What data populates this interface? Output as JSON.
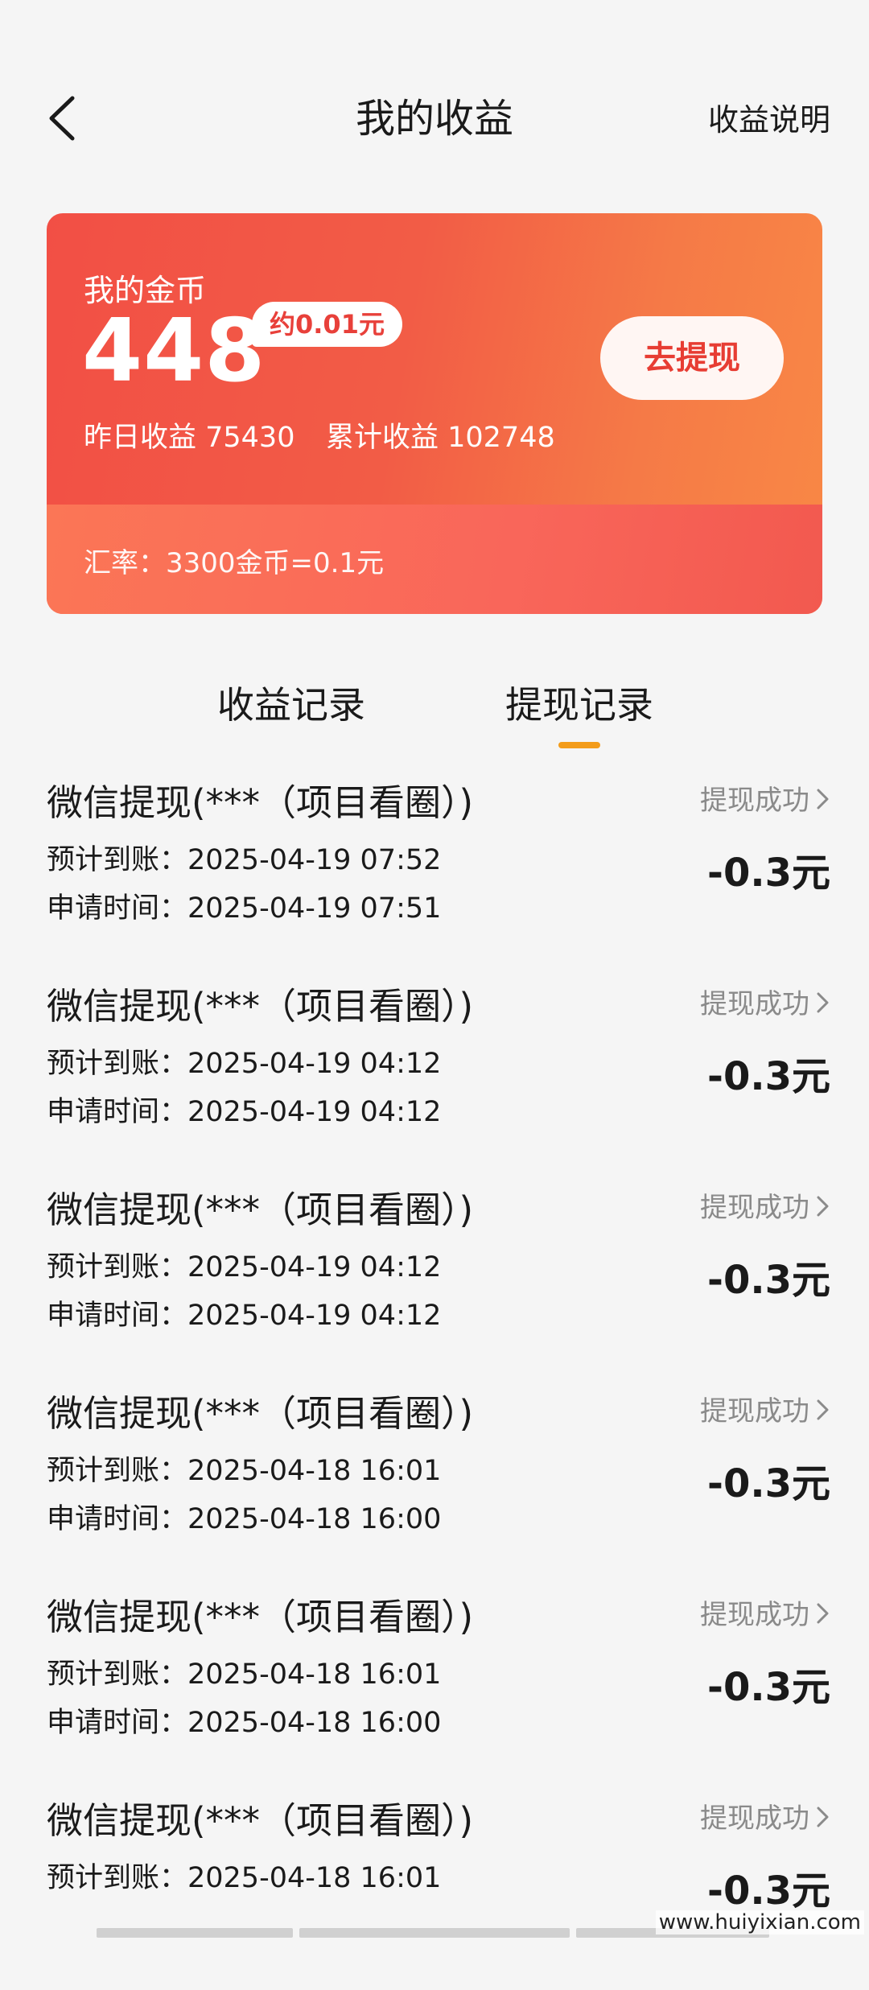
{
  "header": {
    "title": "我的收益",
    "help_link": "收益说明"
  },
  "coin_card": {
    "label": "我的金币",
    "value": "448",
    "approx": "约0.01元",
    "yesterday": "昨日收益 75430",
    "total": "累计收益 102748",
    "withdraw_button": "去提现",
    "rate": "汇率：3300金币=0.1元",
    "colors": {
      "primary": "#f24f45",
      "accent": "#e73d33"
    }
  },
  "tabs": [
    {
      "label": "收益记录",
      "active": false
    },
    {
      "label": "提现记录",
      "active": true
    }
  ],
  "records": [
    {
      "title": "微信提现(***（项目看圈）)",
      "status": "提现成功",
      "expected": "预计到账：2025-04-19 07:52",
      "applied": "申请时间：2025-04-19 07:51",
      "amount": "-0.3元"
    },
    {
      "title": "微信提现(***（项目看圈）)",
      "status": "提现成功",
      "expected": "预计到账：2025-04-19 04:12",
      "applied": "申请时间：2025-04-19 04:12",
      "amount": "-0.3元"
    },
    {
      "title": "微信提现(***（项目看圈）)",
      "status": "提现成功",
      "expected": "预计到账：2025-04-19 04:12",
      "applied": "申请时间：2025-04-19 04:12",
      "amount": "-0.3元"
    },
    {
      "title": "微信提现(***（项目看圈）)",
      "status": "提现成功",
      "expected": "预计到账：2025-04-18 16:01",
      "applied": "申请时间：2025-04-18 16:00",
      "amount": "-0.3元"
    },
    {
      "title": "微信提现(***（项目看圈）)",
      "status": "提现成功",
      "expected": "预计到账：2025-04-18 16:01",
      "applied": "申请时间：2025-04-18 16:00",
      "amount": "-0.3元"
    },
    {
      "title": "微信提现(***（项目看圈）)",
      "status": "提现成功",
      "expected": "预计到账：2025-04-18 16:01",
      "applied": "",
      "amount": "-0.3元"
    }
  ],
  "watermark": "www.huiyixian.com",
  "icons": {
    "back": "chevron-left-icon",
    "status_arrow": "chevron-right-icon"
  }
}
